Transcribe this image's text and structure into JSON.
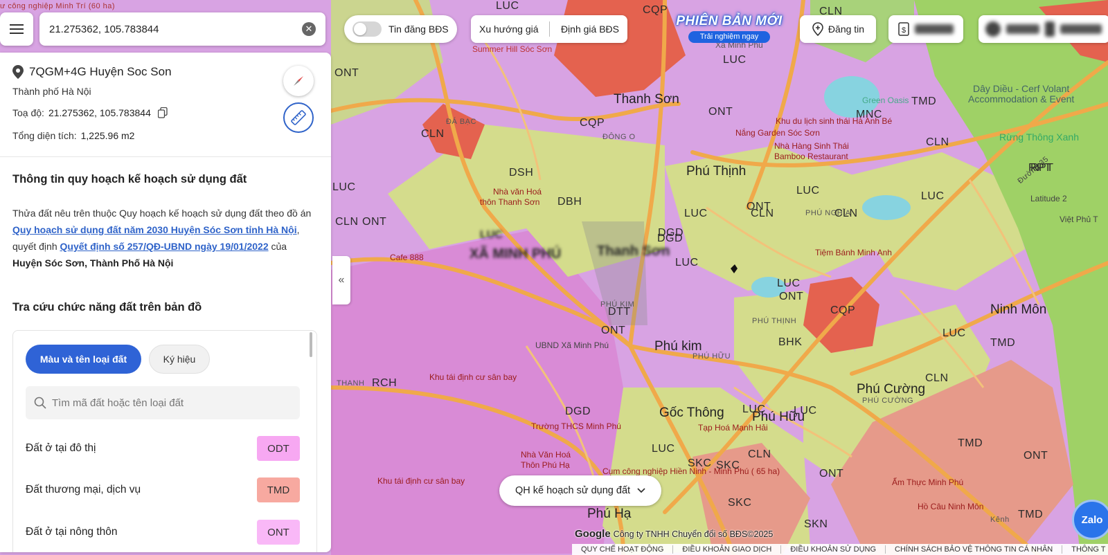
{
  "search": {
    "value": "21.275362, 105.783844"
  },
  "topbar": {
    "listing_toggle_label": "Tin đăng BĐS",
    "price_trend_label": "Xu hướng giá",
    "valuation_label": "Định giá BĐS",
    "version_title": "PHIÊN BẢN MỚI",
    "version_subtitle": "Trải nghiệm ngay",
    "post_label": "Đăng tin"
  },
  "place": {
    "plus_code": "7QGM+4G Huyện Soc Son",
    "city": "Thành phố Hà Nội",
    "coords_label": "Toạ độ:",
    "coords": "21.275362, 105.783844",
    "area_label": "Tổng diện tích:",
    "area": "1,225.96 m2"
  },
  "planning": {
    "title": "Thông tin quy hoạch kế hoạch sử dụng đất",
    "text_1": "Thửa đất nêu trên thuộc Quy hoạch kế hoạch sử dụng đất theo đồ án",
    "link_1": "Quy hoạch sử dụng đất năm 2030 Huyện Sóc Sơn tỉnh Hà Nội",
    "text_2": ", quyết định",
    "link_2": "Quyết định số 257/QĐ-UBND ngày 19/01/2022",
    "text_3": "của",
    "district": "Huyện Sóc Sơn, Thành Phố Hà Nội"
  },
  "legend": {
    "title": "Tra cứu chức năng đất trên bản đồ",
    "tab_color": "Màu và tên loại đất",
    "tab_symbol": "Ký hiệu",
    "search_placeholder": "Tìm mã đất hoặc tên loại đất",
    "rows": [
      {
        "name": "Đất ở tại đô thị",
        "code": "ODT",
        "color": "#f7a8f2"
      },
      {
        "name": "Đất thương mại, dịch vụ",
        "code": "TMD",
        "color": "#f7a9a0"
      },
      {
        "name": "Đất ở tại nông thôn",
        "code": "ONT",
        "color": "#f9b8f7"
      }
    ]
  },
  "map": {
    "plan_selector": "QH kế hoạch sử dụng đất",
    "attribution": "Công ty TNHH Chuyển đổi số BĐS©2025",
    "google": "Google",
    "zalo": "Zalo",
    "labels": {
      "thanh_son": "Thanh Sơn",
      "phu_thinh": "Phú Thịnh",
      "phu_kim": "Phú kim",
      "goc_thong": "Gốc Thông",
      "phu_huu": "Phú Hữu",
      "phu_cuong": "Phú Cường",
      "ninh_mon": "Ninh Môn",
      "phu_ha": "Phú Hạ",
      "xa_minh_phu_top": "Xã Minh Phú",
      "summer_hill": "Summer Hill Sóc Sơn",
      "green_oasis": "Green Oasis",
      "day_dieu": "Dây Diều - Cerf Volant",
      "accommodation": "Accommodation & Event",
      "rung_thong": "Rừng Thông Xanh",
      "khu_du_lich": "Khu du lịch sinh thái Hà Anh Bé",
      "nang_garden": "Nắng Garden Sóc Sơn",
      "nha_hang": "Nhà Hàng Sinh Thái",
      "bamboo": "Bamboo Restaurant",
      "nha_van_hoa": "Nhà văn Hoá",
      "thon_thanh_son": "thôn Thanh Sơn",
      "tiem_banh": "Tiệm Bánh Minh Anh",
      "ubnd": "UBND Xã Minh Phú",
      "khu_tai_dinh_cu_1": "Khu tái định cư sân bay",
      "khu_tai_dinh_cu_2": "Khu tái định cư sân bay",
      "truong": "Trường THCS Minh Phú",
      "nha_van_hoa_2": "Nhà Văn Hoá",
      "thon_phu_ha": "Thôn Phú Hạ",
      "tap_hoa": "Tạp Hoá Mạnh Hải",
      "cum_cong_nghiep": "Cụm công nghiệp Hiền Ninh - Minh Phú ( 65 ha)",
      "am_thuc": "Ẩm Thực Minh Phú",
      "ho_cau": "Hồ Câu Ninh Môn",
      "cafe": "Cafe 888",
      "dong_o": "ĐÔNG O",
      "da_bac": "ĐÁ BẠC",
      "phu_nghia": "PHÚ NGHĨA",
      "phu_kim_small": "PHÚ KIM",
      "phu_thinh_small": "PHÚ THỊNH",
      "phu_huu_small": "PHÚ HỮU",
      "phu_cuong_small": "PHÚ CƯỜNG",
      "xa_minh_phu_blur": "XÃ MINH PHÚ",
      "thanh_son_blur": "Thanh Sơn",
      "luc_blur": "LUC",
      "quarter": "ư công nghiệp Minh Trí (60 ha)",
      "latitude": "Latitude 2",
      "viet_phu": "Việt Phủ T",
      "thanh": "THANH",
      "duong35": "Đường 35",
      "kenh": "Kênh",
      "codes": [
        "CQP",
        "CLN",
        "LUC",
        "ONT",
        "TMD",
        "MNC",
        "DSH",
        "DBH",
        "DGD",
        "DTT",
        "BHK",
        "RPT",
        "SKC",
        "RCH",
        "SKN",
        "CLN",
        "CQP",
        "ONT",
        "LUC",
        "CLN",
        "LUC",
        "ONT",
        "CLN",
        "LUC",
        "TMD",
        "TMD",
        "LUC",
        "CLN",
        "LUC",
        "SKC",
        "LUC",
        "ONT",
        "CLN",
        "LUC",
        "SKC",
        "CQP",
        "ONT",
        "DGD",
        "ONT",
        "LUC",
        "TMD",
        "ONT",
        "CLN",
        "LUC",
        "ONT",
        "LUC",
        "RPT",
        "LUC",
        "CLN",
        "DGD"
      ]
    }
  },
  "footer": {
    "links": [
      "QUY CHẾ HOẠT ĐỘNG",
      "ĐIỀU KHOẢN GIAO DỊCH",
      "ĐIỀU KHOẢN SỬ DỤNG",
      "CHÍNH SÁCH BẢO VỆ THÔNG TIN CÁ NHÂN",
      "THÔNG T"
    ]
  }
}
